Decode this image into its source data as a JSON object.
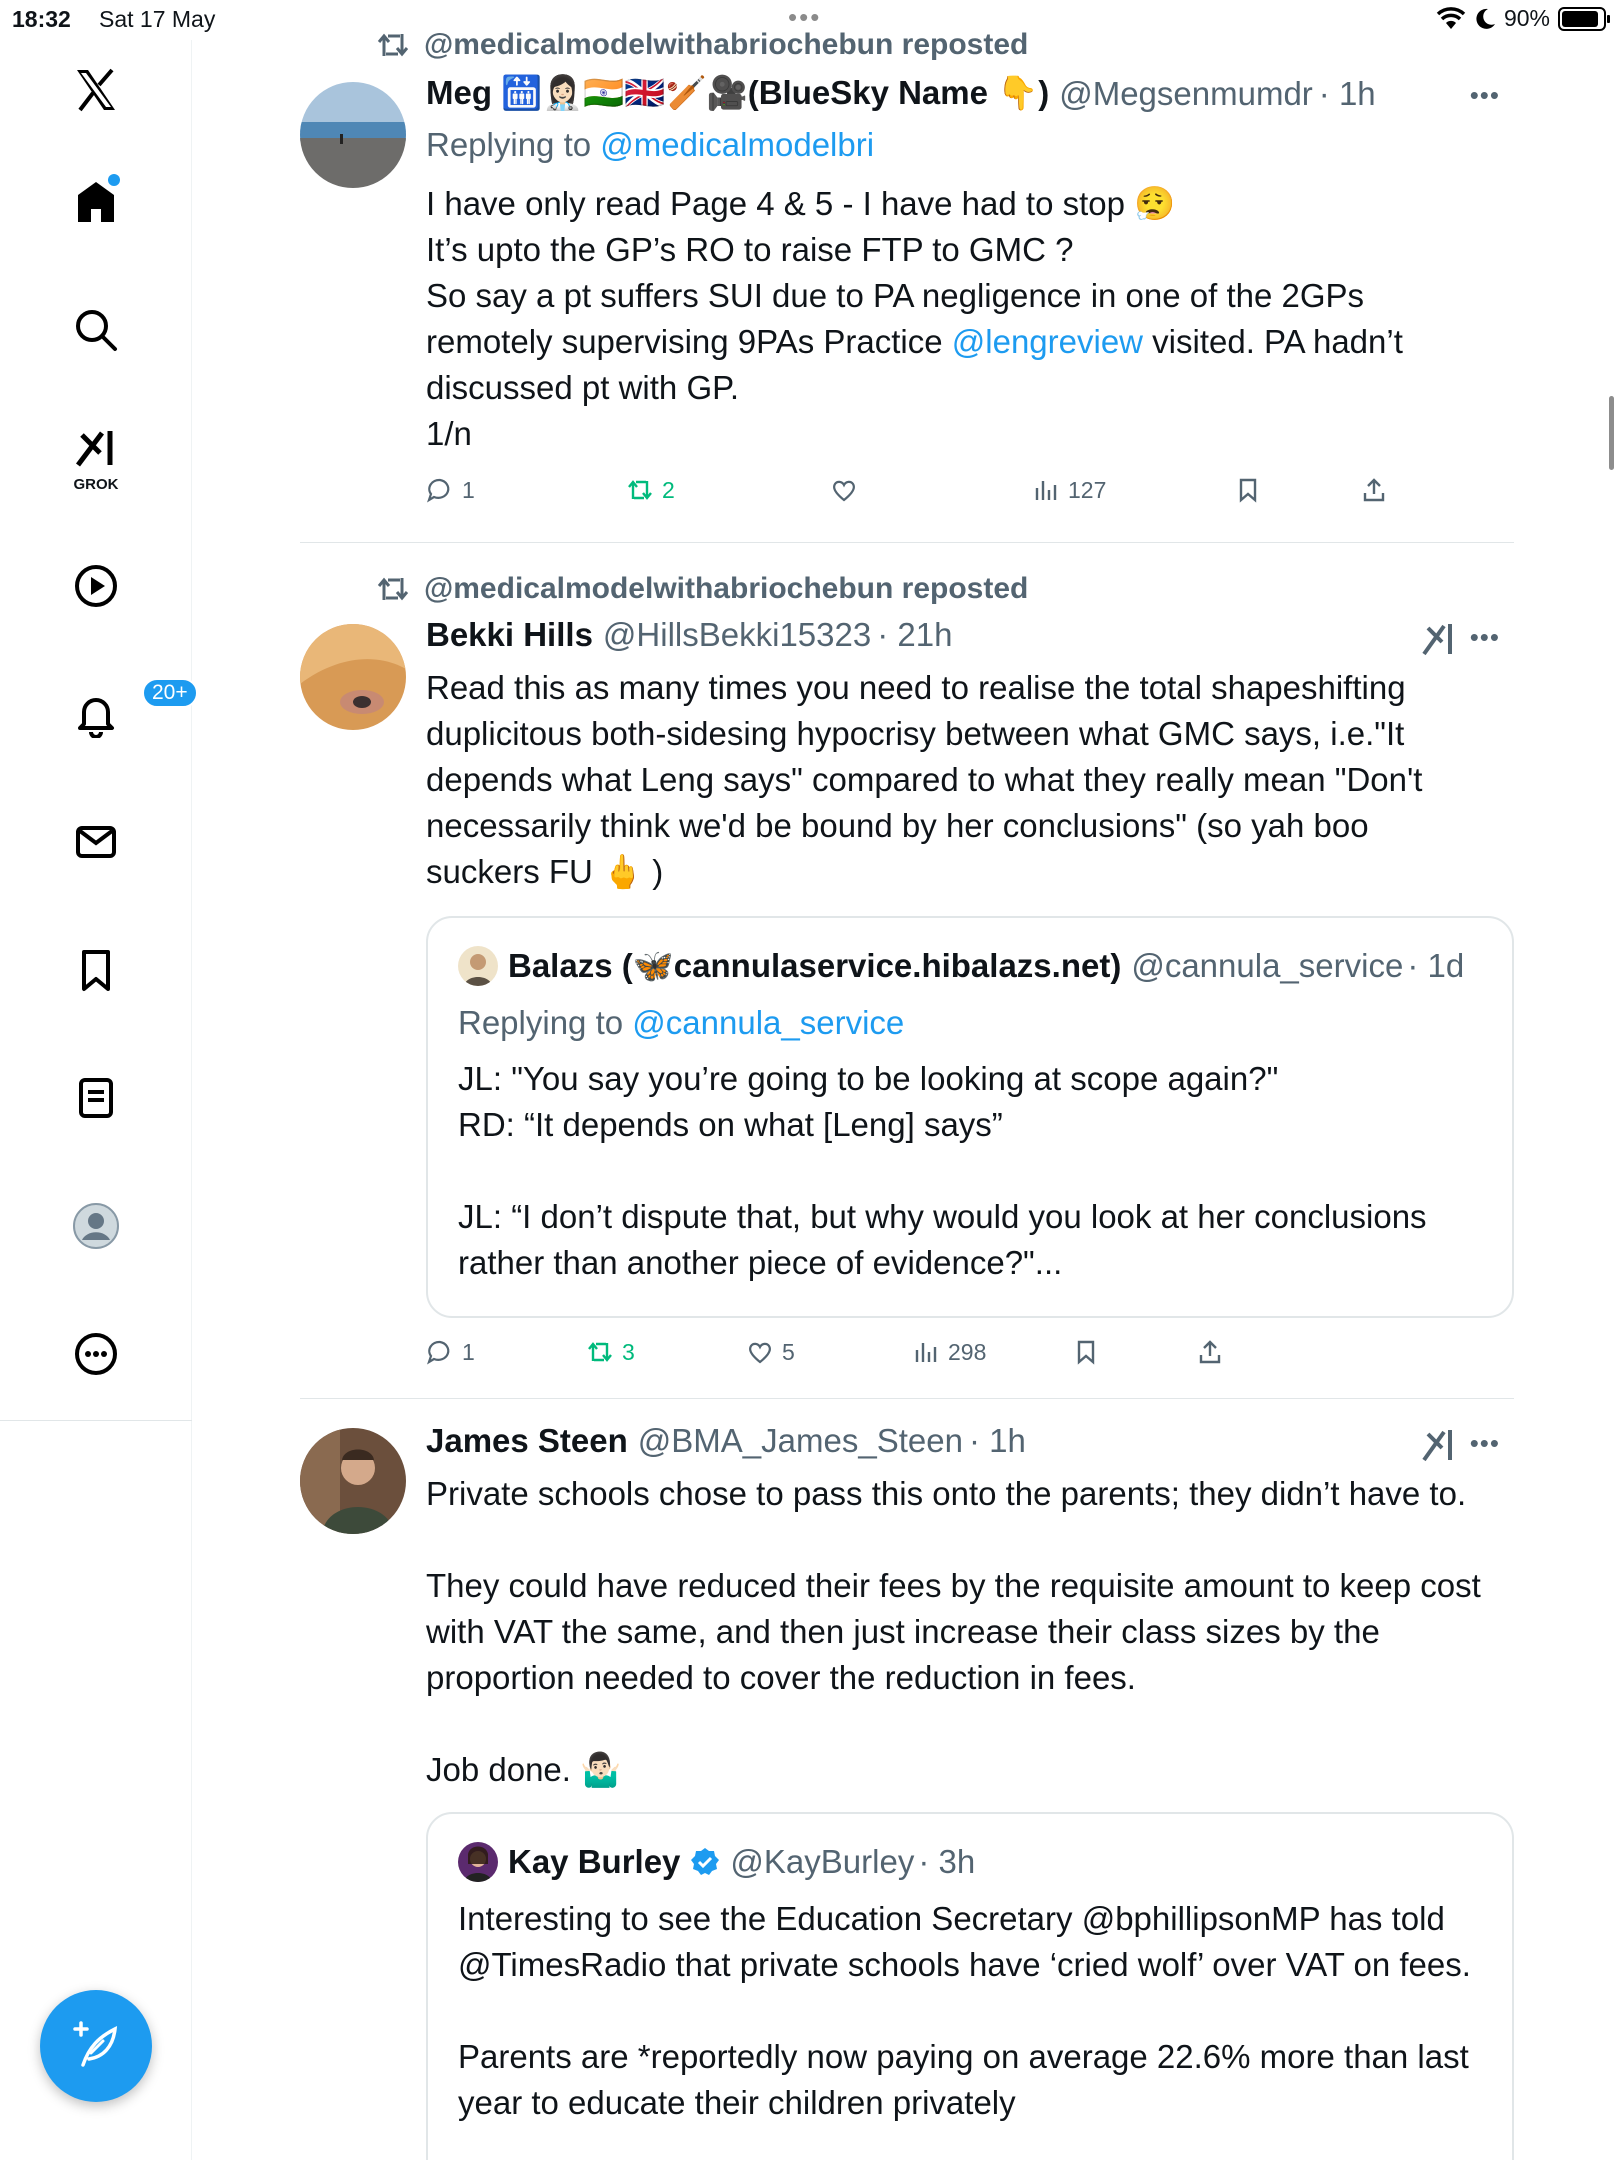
{
  "status": {
    "time": "18:32",
    "date": "Sat 17 May",
    "battery": "90%",
    "battery_level": 0.9
  },
  "sidebar": {
    "grok_label": "GROK",
    "notifications_badge": "20+"
  },
  "posts": [
    {
      "repost_by": "@medicalmodelwithabriochebun reposted",
      "name": "Meg 🛗👩🏻‍⚕️🇮🇳🇬🇧🏏🎥(BlueSky Name 👇)",
      "handle": "@Megsenmumdr",
      "time": "· 1h",
      "replying_label": "Replying to",
      "replying_handle": "@medicalmodelbri",
      "text_before": "I have only read Page 4 & 5 - I have had to stop 😮‍💨\nIt’s upto the GP’s RO to raise FTP to GMC ?\nSo say a pt suffers SUI due to PA negligence in one of the 2GPs remotely supervising 9PAs Practice ",
      "text_link": "@lengreview",
      "text_after": " visited. PA hadn’t discussed pt with GP.\n1/n",
      "replies": "1",
      "reposts": "2",
      "likes": "",
      "views": "127"
    },
    {
      "repost_by": "@medicalmodelwithabriochebun reposted",
      "name": "Bekki Hills",
      "handle": "@HillsBekki15323",
      "time": "· 21h",
      "text": "Read this as many times you need to realise the total shapeshifting duplicitous both-sidesing hypocrisy between what GMC says, i.e.\"It depends what Leng says\" compared to what they really mean \"Don't necessarily think we'd be bound by her conclusions\" (so yah boo suckers FU 🖕 )",
      "quote": {
        "name": "Balazs (🦋cannulaservice.hibalazs.net)",
        "handle": "@cannula_service",
        "time": "· 1d",
        "replying_label": "Replying to",
        "replying_handle": "@cannula_service",
        "text": "JL: \"You say you’re going to be looking at scope again?\"\nRD: “It depends on what [Leng] says”\n\nJL: “I don’t dispute that, but why would you look at her conclusions rather than another piece of evidence?\"..."
      },
      "replies": "1",
      "reposts": "3",
      "likes": "5",
      "views": "298"
    },
    {
      "name": "James Steen",
      "handle": "@BMA_James_Steen",
      "time": "· 1h",
      "text": "Private schools chose to pass this onto the parents; they didn’t have to.\n\nThey could have reduced their fees by the requisite amount to keep cost with VAT the same, and then just increase their class sizes by the proportion needed to cover the reduction in fees.\n\nJob done. 🤷🏻‍♂️",
      "quote": {
        "name": "Kay Burley",
        "handle": "@KayBurley",
        "time": "· 3h",
        "text": "Interesting to see the Education Secretary @bphillipsonMP has told @TimesRadio that private schools have ‘cried wolf’ over VAT on fees.\n\nParents are *reportedly now paying on average 22.6% more than last year to educate their children privately"
      }
    }
  ],
  "colors": {
    "accent": "#1d9bf0",
    "repost_green": "#00ba7c",
    "muted": "#536471"
  }
}
